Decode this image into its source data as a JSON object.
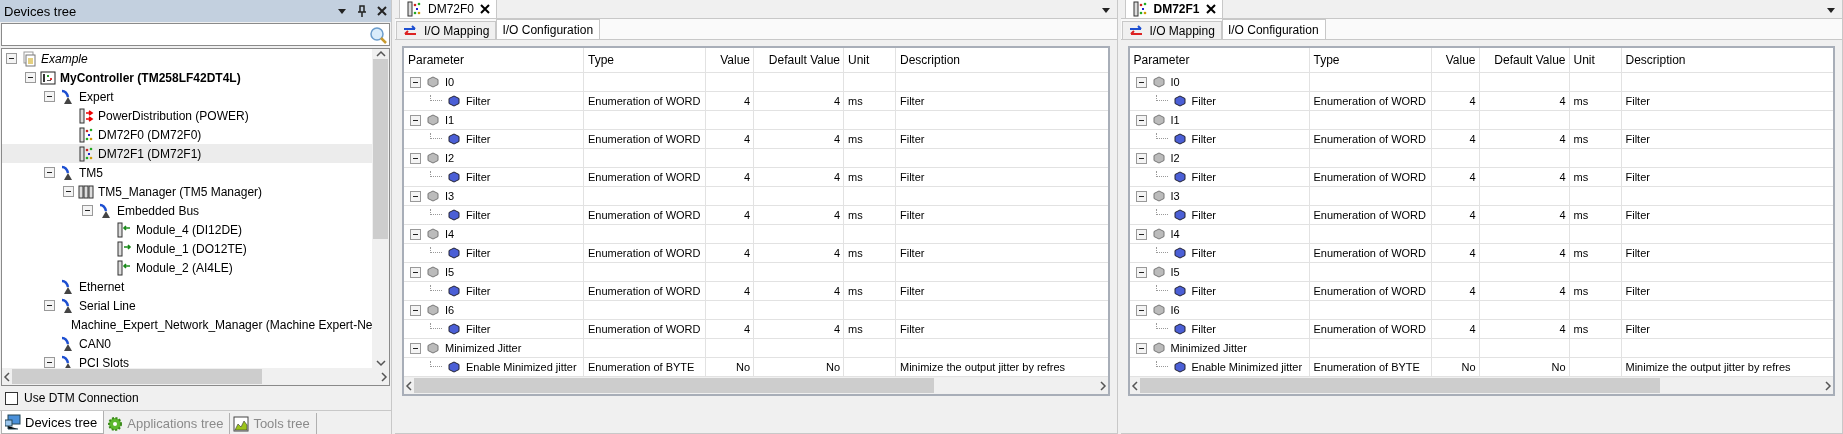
{
  "devices_panel": {
    "title": "Devices tree",
    "tree": [
      {
        "label": "Example",
        "kind": "project",
        "expanded": true,
        "selected": false,
        "children": [
          {
            "label": "MyController (TM258LF42DT4L)",
            "kind": "controller",
            "expanded": true,
            "selected": false,
            "children": [
              {
                "label": "Expert",
                "kind": "bus",
                "expanded": true,
                "selected": false,
                "children": [
                  {
                    "label": "PowerDistribution (POWER)",
                    "kind": "power",
                    "selected": false
                  },
                  {
                    "label": "DM72F0 (DM72F0)",
                    "kind": "io",
                    "selected": false
                  },
                  {
                    "label": "DM72F1 (DM72F1)",
                    "kind": "io",
                    "selected": true
                  }
                ]
              },
              {
                "label": "TM5",
                "kind": "bus",
                "expanded": true,
                "selected": false,
                "children": [
                  {
                    "label": "TM5_Manager (TM5 Manager)",
                    "kind": "rack",
                    "expanded": true,
                    "selected": false,
                    "children": [
                      {
                        "label": "Embedded Bus",
                        "kind": "bus",
                        "expanded": true,
                        "selected": false,
                        "children": [
                          {
                            "label": "Module_4 (DI12DE)",
                            "kind": "module-in",
                            "selected": false
                          },
                          {
                            "label": "Module_1 (DO12TE)",
                            "kind": "module-out",
                            "selected": false
                          },
                          {
                            "label": "Module_2 (AI4LE)",
                            "kind": "module-in",
                            "selected": false
                          }
                        ]
                      }
                    ]
                  }
                ]
              },
              {
                "label": "Ethernet",
                "kind": "bus",
                "selected": false
              },
              {
                "label": "Serial Line",
                "kind": "bus",
                "expanded": true,
                "selected": false,
                "children": [
                  {
                    "label": "Machine_Expert_Network_Manager (Machine Expert-Ne",
                    "kind": "network",
                    "selected": false
                  }
                ]
              },
              {
                "label": "CAN0",
                "kind": "bus",
                "selected": false
              },
              {
                "label": "PCI Slots",
                "kind": "bus",
                "expanded": true,
                "selected": false
              }
            ]
          }
        ]
      }
    ],
    "use_dtm_connection": {
      "label": "Use DTM Connection",
      "checked": false
    },
    "bottom_tabs": [
      {
        "label": "Devices tree",
        "kind": "devices",
        "selected": true
      },
      {
        "label": "Applications tree",
        "kind": "applications",
        "selected": false
      },
      {
        "label": "Tools tree",
        "kind": "tools",
        "selected": false
      }
    ]
  },
  "editors": [
    {
      "tab": {
        "title": "DM72F0",
        "selected": false
      },
      "subtabs": [
        {
          "label": "I/O Mapping",
          "kind": "mapping",
          "selected": false
        },
        {
          "label": "I/O Configuration",
          "kind": "config",
          "selected": true
        }
      ],
      "columns": [
        "Parameter",
        "Type",
        "Value",
        "Default Value",
        "Unit",
        "Description"
      ],
      "groups": [
        {
          "name": "I0",
          "expanded": true,
          "children": [
            {
              "name": "Filter",
              "type": "Enumeration of WORD",
              "value": "4",
              "default": "4",
              "unit": "ms",
              "description": "Filter"
            }
          ]
        },
        {
          "name": "I1",
          "expanded": true,
          "children": [
            {
              "name": "Filter",
              "type": "Enumeration of WORD",
              "value": "4",
              "default": "4",
              "unit": "ms",
              "description": "Filter"
            }
          ]
        },
        {
          "name": "I2",
          "expanded": true,
          "children": [
            {
              "name": "Filter",
              "type": "Enumeration of WORD",
              "value": "4",
              "default": "4",
              "unit": "ms",
              "description": "Filter"
            }
          ]
        },
        {
          "name": "I3",
          "expanded": true,
          "children": [
            {
              "name": "Filter",
              "type": "Enumeration of WORD",
              "value": "4",
              "default": "4",
              "unit": "ms",
              "description": "Filter"
            }
          ]
        },
        {
          "name": "I4",
          "expanded": true,
          "children": [
            {
              "name": "Filter",
              "type": "Enumeration of WORD",
              "value": "4",
              "default": "4",
              "unit": "ms",
              "description": "Filter"
            }
          ]
        },
        {
          "name": "I5",
          "expanded": true,
          "children": [
            {
              "name": "Filter",
              "type": "Enumeration of WORD",
              "value": "4",
              "default": "4",
              "unit": "ms",
              "description": "Filter"
            }
          ]
        },
        {
          "name": "I6",
          "expanded": true,
          "children": [
            {
              "name": "Filter",
              "type": "Enumeration of WORD",
              "value": "4",
              "default": "4",
              "unit": "ms",
              "description": "Filter"
            }
          ]
        },
        {
          "name": "Minimized Jitter",
          "expanded": true,
          "children": [
            {
              "name": "Enable Minimized jitter",
              "type": "Enumeration of BYTE",
              "value": "No",
              "default": "No",
              "description": "Minimize the output jitter by refres"
            }
          ]
        }
      ]
    },
    {
      "tab": {
        "title": "DM72F1",
        "selected": true
      },
      "subtabs": [
        {
          "label": "I/O Mapping",
          "kind": "mapping",
          "selected": false
        },
        {
          "label": "I/O Configuration",
          "kind": "config",
          "selected": true
        }
      ],
      "columns": [
        "Parameter",
        "Type",
        "Value",
        "Default Value",
        "Unit",
        "Description"
      ],
      "groups": [
        {
          "name": "I0",
          "expanded": true,
          "children": [
            {
              "name": "Filter",
              "type": "Enumeration of WORD",
              "value": "4",
              "default": "4",
              "unit": "ms",
              "description": "Filter"
            }
          ]
        },
        {
          "name": "I1",
          "expanded": true,
          "children": [
            {
              "name": "Filter",
              "type": "Enumeration of WORD",
              "value": "4",
              "default": "4",
              "unit": "ms",
              "description": "Filter"
            }
          ]
        },
        {
          "name": "I2",
          "expanded": true,
          "children": [
            {
              "name": "Filter",
              "type": "Enumeration of WORD",
              "value": "4",
              "default": "4",
              "unit": "ms",
              "description": "Filter"
            }
          ]
        },
        {
          "name": "I3",
          "expanded": true,
          "children": [
            {
              "name": "Filter",
              "type": "Enumeration of WORD",
              "value": "4",
              "default": "4",
              "unit": "ms",
              "description": "Filter"
            }
          ]
        },
        {
          "name": "I4",
          "expanded": true,
          "children": [
            {
              "name": "Filter",
              "type": "Enumeration of WORD",
              "value": "4",
              "default": "4",
              "unit": "ms",
              "description": "Filter"
            }
          ]
        },
        {
          "name": "I5",
          "expanded": true,
          "children": [
            {
              "name": "Filter",
              "type": "Enumeration of WORD",
              "value": "4",
              "default": "4",
              "unit": "ms",
              "description": "Filter"
            }
          ]
        },
        {
          "name": "I6",
          "expanded": true,
          "children": [
            {
              "name": "Filter",
              "type": "Enumeration of WORD",
              "value": "4",
              "default": "4",
              "unit": "ms",
              "description": "Filter"
            }
          ]
        },
        {
          "name": "Minimized Jitter",
          "expanded": true,
          "children": [
            {
              "name": "Enable Minimized jitter",
              "type": "Enumeration of BYTE",
              "value": "No",
              "default": "No",
              "description": "Minimize the output jitter by refres"
            }
          ]
        }
      ]
    }
  ]
}
